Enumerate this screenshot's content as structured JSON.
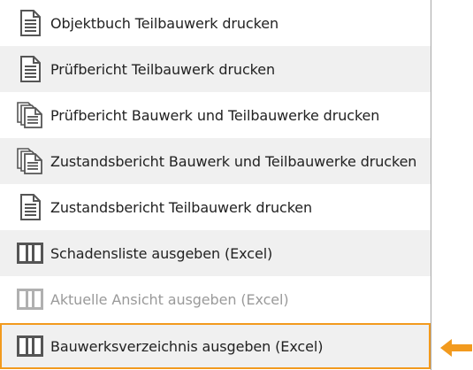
{
  "menu": {
    "items": [
      {
        "label": "Objektbuch Teilbauwerk drucken",
        "icon": "single-document-icon",
        "state": "normal"
      },
      {
        "label": "Prüfbericht Teilbauwerk drucken",
        "icon": "single-document-icon",
        "state": "normal"
      },
      {
        "label": "Prüfbericht Bauwerk und Teilbauwerke drucken",
        "icon": "multiple-documents-icon",
        "state": "normal"
      },
      {
        "label": "Zustandsbericht Bauwerk und Teilbauwerke drucken",
        "icon": "multiple-documents-icon",
        "state": "normal"
      },
      {
        "label": "Zustandsbericht Teilbauwerk drucken",
        "icon": "single-document-icon",
        "state": "normal"
      },
      {
        "label": "Schadensliste ausgeben (Excel)",
        "icon": "table-columns-icon",
        "state": "normal"
      },
      {
        "label": "Aktuelle Ansicht ausgeben (Excel)",
        "icon": "table-columns-icon",
        "state": "disabled"
      },
      {
        "label": "Bauwerksverzeichnis ausgeben (Excel)",
        "icon": "table-columns-icon",
        "state": "highlighted"
      }
    ]
  },
  "colors": {
    "highlight": "#f29a1e",
    "row_shade": "#f0f0f0",
    "icon": "#555555",
    "icon_disabled": "#b0b0b0",
    "text": "#222222",
    "text_disabled": "#9a9a9a"
  }
}
